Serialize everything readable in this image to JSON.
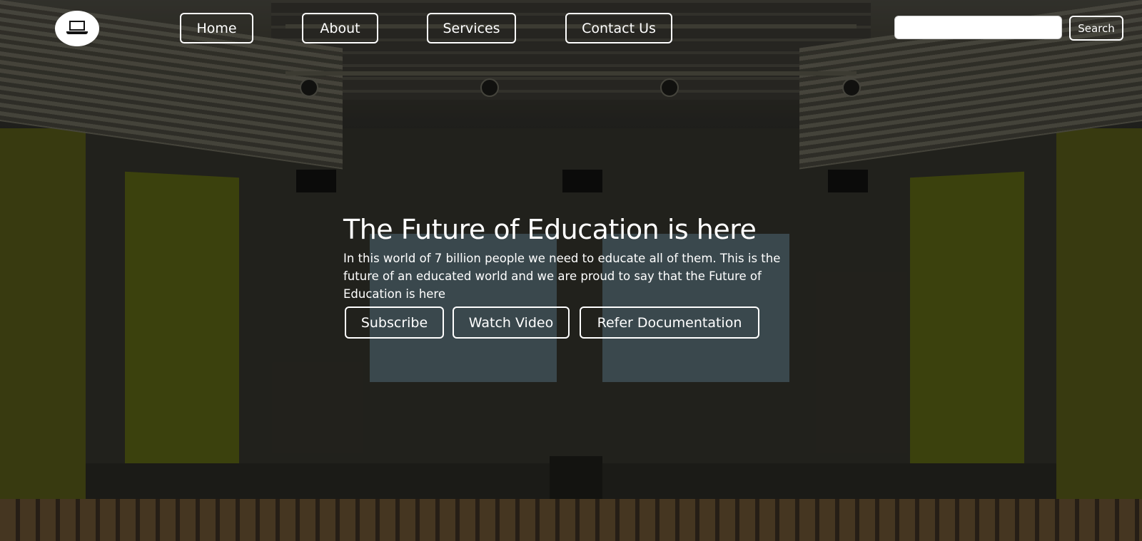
{
  "nav": {
    "logo_icon": "laptop-icon",
    "links": [
      {
        "label": "Home"
      },
      {
        "label": "About"
      },
      {
        "label": "Services"
      },
      {
        "label": "Contact Us"
      }
    ],
    "search": {
      "value": "",
      "placeholder": "",
      "button_label": "Search"
    }
  },
  "hero": {
    "title": "The Future of Education is here",
    "text": "In this world of 7 billion people we need to educate all of them. This is the future of an educated world and we are proud to say that the Future of Education is here",
    "buttons": [
      {
        "label": "Subscribe"
      },
      {
        "label": "Watch Video"
      },
      {
        "label": "Refer Documentation"
      }
    ]
  },
  "colors": {
    "button_border": "#ffffff",
    "text": "#ffffff",
    "overlay": "#000000"
  }
}
